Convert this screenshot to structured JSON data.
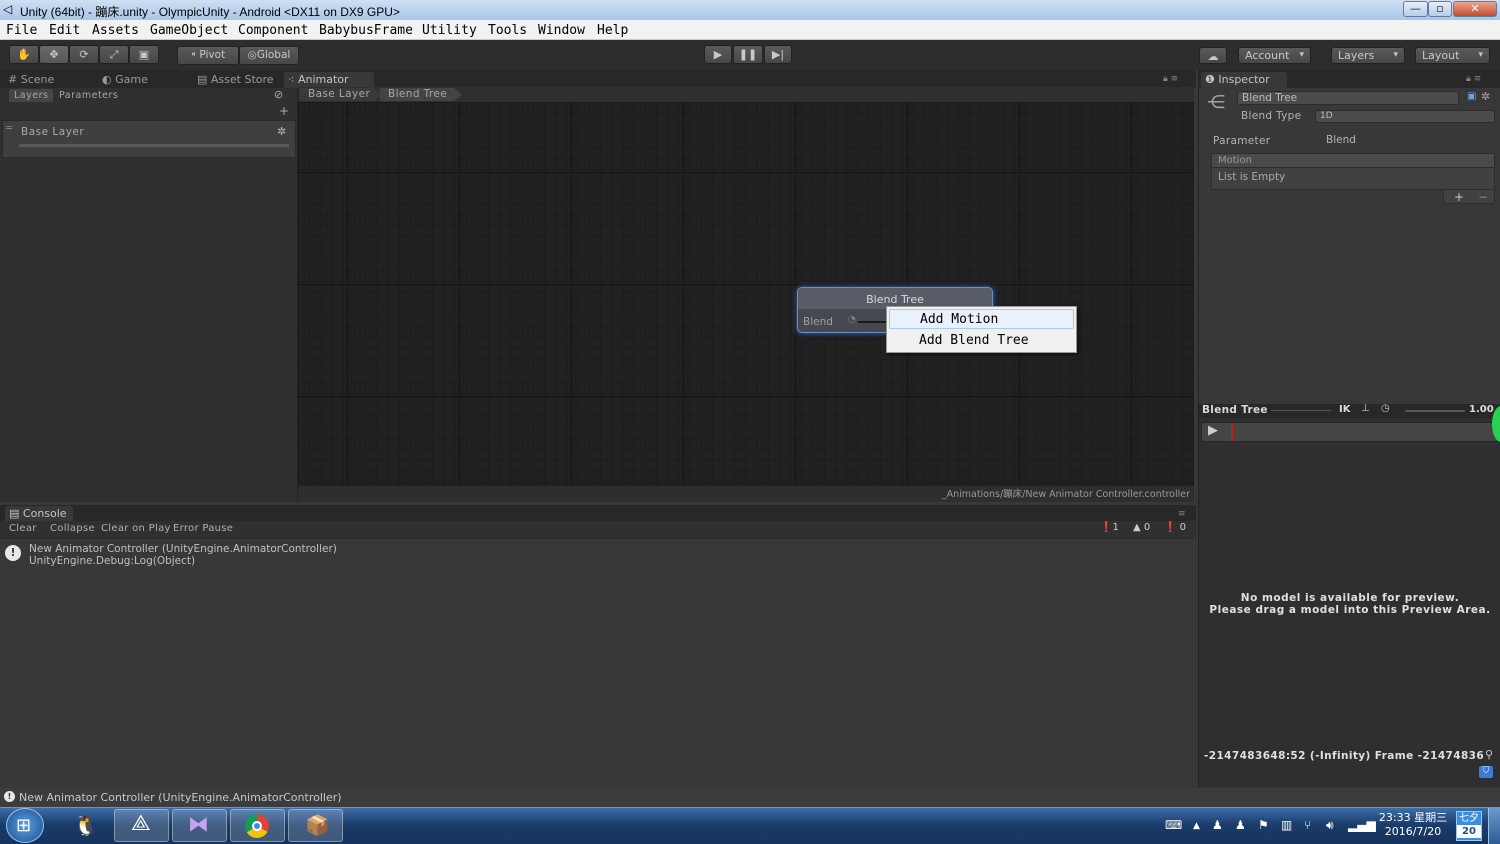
{
  "window": {
    "title": "Unity (64bit) - 蹦床.unity - OlympicUnity - Android <DX11 on DX9 GPU>",
    "controls": [
      "—",
      "▫",
      "✕"
    ]
  },
  "menu": [
    "File",
    "Edit",
    "Assets",
    "GameObject",
    "Component",
    "BabybusFrame",
    "Utility",
    "Tools",
    "Window",
    "Help"
  ],
  "toolbar": {
    "pivot": "Pivot",
    "global": "Global",
    "account": "Account",
    "layers": "Layers",
    "layout": "Layout"
  },
  "tabs": {
    "scene": "Scene",
    "game": "Game",
    "asset_store": "Asset Store",
    "animator": "Animator",
    "inspector": "Inspector",
    "console": "Console"
  },
  "animator": {
    "subtabs": [
      "Layers",
      "Parameters"
    ],
    "base_layer": "Base Layer",
    "breadcrumb": [
      "Base Layer",
      "Blend Tree"
    ],
    "node_title": "Blend Tree",
    "node_param": "Blend",
    "footer_path": "_Animations/蹦床/New Animator Controller.controller"
  },
  "context_menu": [
    "Add Motion",
    "Add Blend Tree"
  ],
  "inspector": {
    "name_value": "Blend Tree",
    "blend_type_label": "Blend Type",
    "blend_type_value": "1D",
    "parameter_label": "Parameter",
    "parameter_value": "Blend",
    "motion_header": "Motion",
    "motion_empty": "List is Empty",
    "add": "+",
    "remove": "−"
  },
  "preview": {
    "title": "Blend Tree",
    "ik": "IK",
    "speed": "1.00",
    "no_model_line1": "No model is available for preview.",
    "no_model_line2": "Please drag a model into this Preview Area.",
    "frame_text": "-2147483648:52 (-Infinity) Frame -21474836"
  },
  "console": {
    "buttons": [
      "Clear",
      "Collapse",
      "Clear on Play",
      "Error Pause"
    ],
    "counts": {
      "info": "1",
      "warn": "0",
      "error": "0"
    },
    "log_line1": "New Animator Controller (UnityEngine.AnimatorController)",
    "log_line2": "UnityEngine.Debug:Log(Object)"
  },
  "status": "New Animator Controller (UnityEngine.AnimatorController)",
  "taskbar": {
    "time": "23:33 星期三",
    "date": "2016/7/20",
    "calendar_top": "七夕",
    "calendar_day": "20"
  },
  "colors": {
    "editor_bg": "#383838",
    "graph_bg": "#212121",
    "node_border": "#6d8fc8",
    "taskbar": "#1b3d6b"
  }
}
